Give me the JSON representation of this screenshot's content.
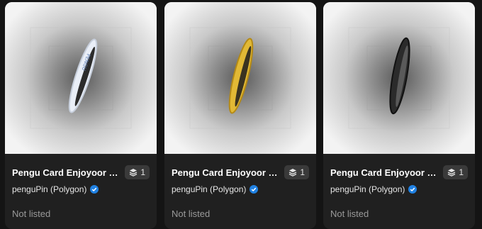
{
  "cards": [
    {
      "title": "Pengu Card Enjoyoor - S...",
      "edition_count": "1",
      "creator": "penguPin (Polygon)",
      "status": "Not listed",
      "coin_color": "#e9eef7",
      "coin_accent": "#5f7fb5"
    },
    {
      "title": "Pengu Card Enjoyoor - G...",
      "edition_count": "1",
      "creator": "penguPin (Polygon)",
      "status": "Not listed",
      "coin_color": "#e2b935",
      "coin_accent": "#b48a17"
    },
    {
      "title": "Pengu Card Enjoyoor - B...",
      "edition_count": "1",
      "creator": "penguPin (Polygon)",
      "status": "Not listed",
      "coin_color": "#2b2b2b",
      "coin_accent": "#5a5a5a"
    }
  ],
  "colors": {
    "page_background": "#141414",
    "card_background": "#202020",
    "badge_background": "#3a3a3a",
    "verified_blue": "#2081e2",
    "muted_text": "#9a9a9a"
  }
}
